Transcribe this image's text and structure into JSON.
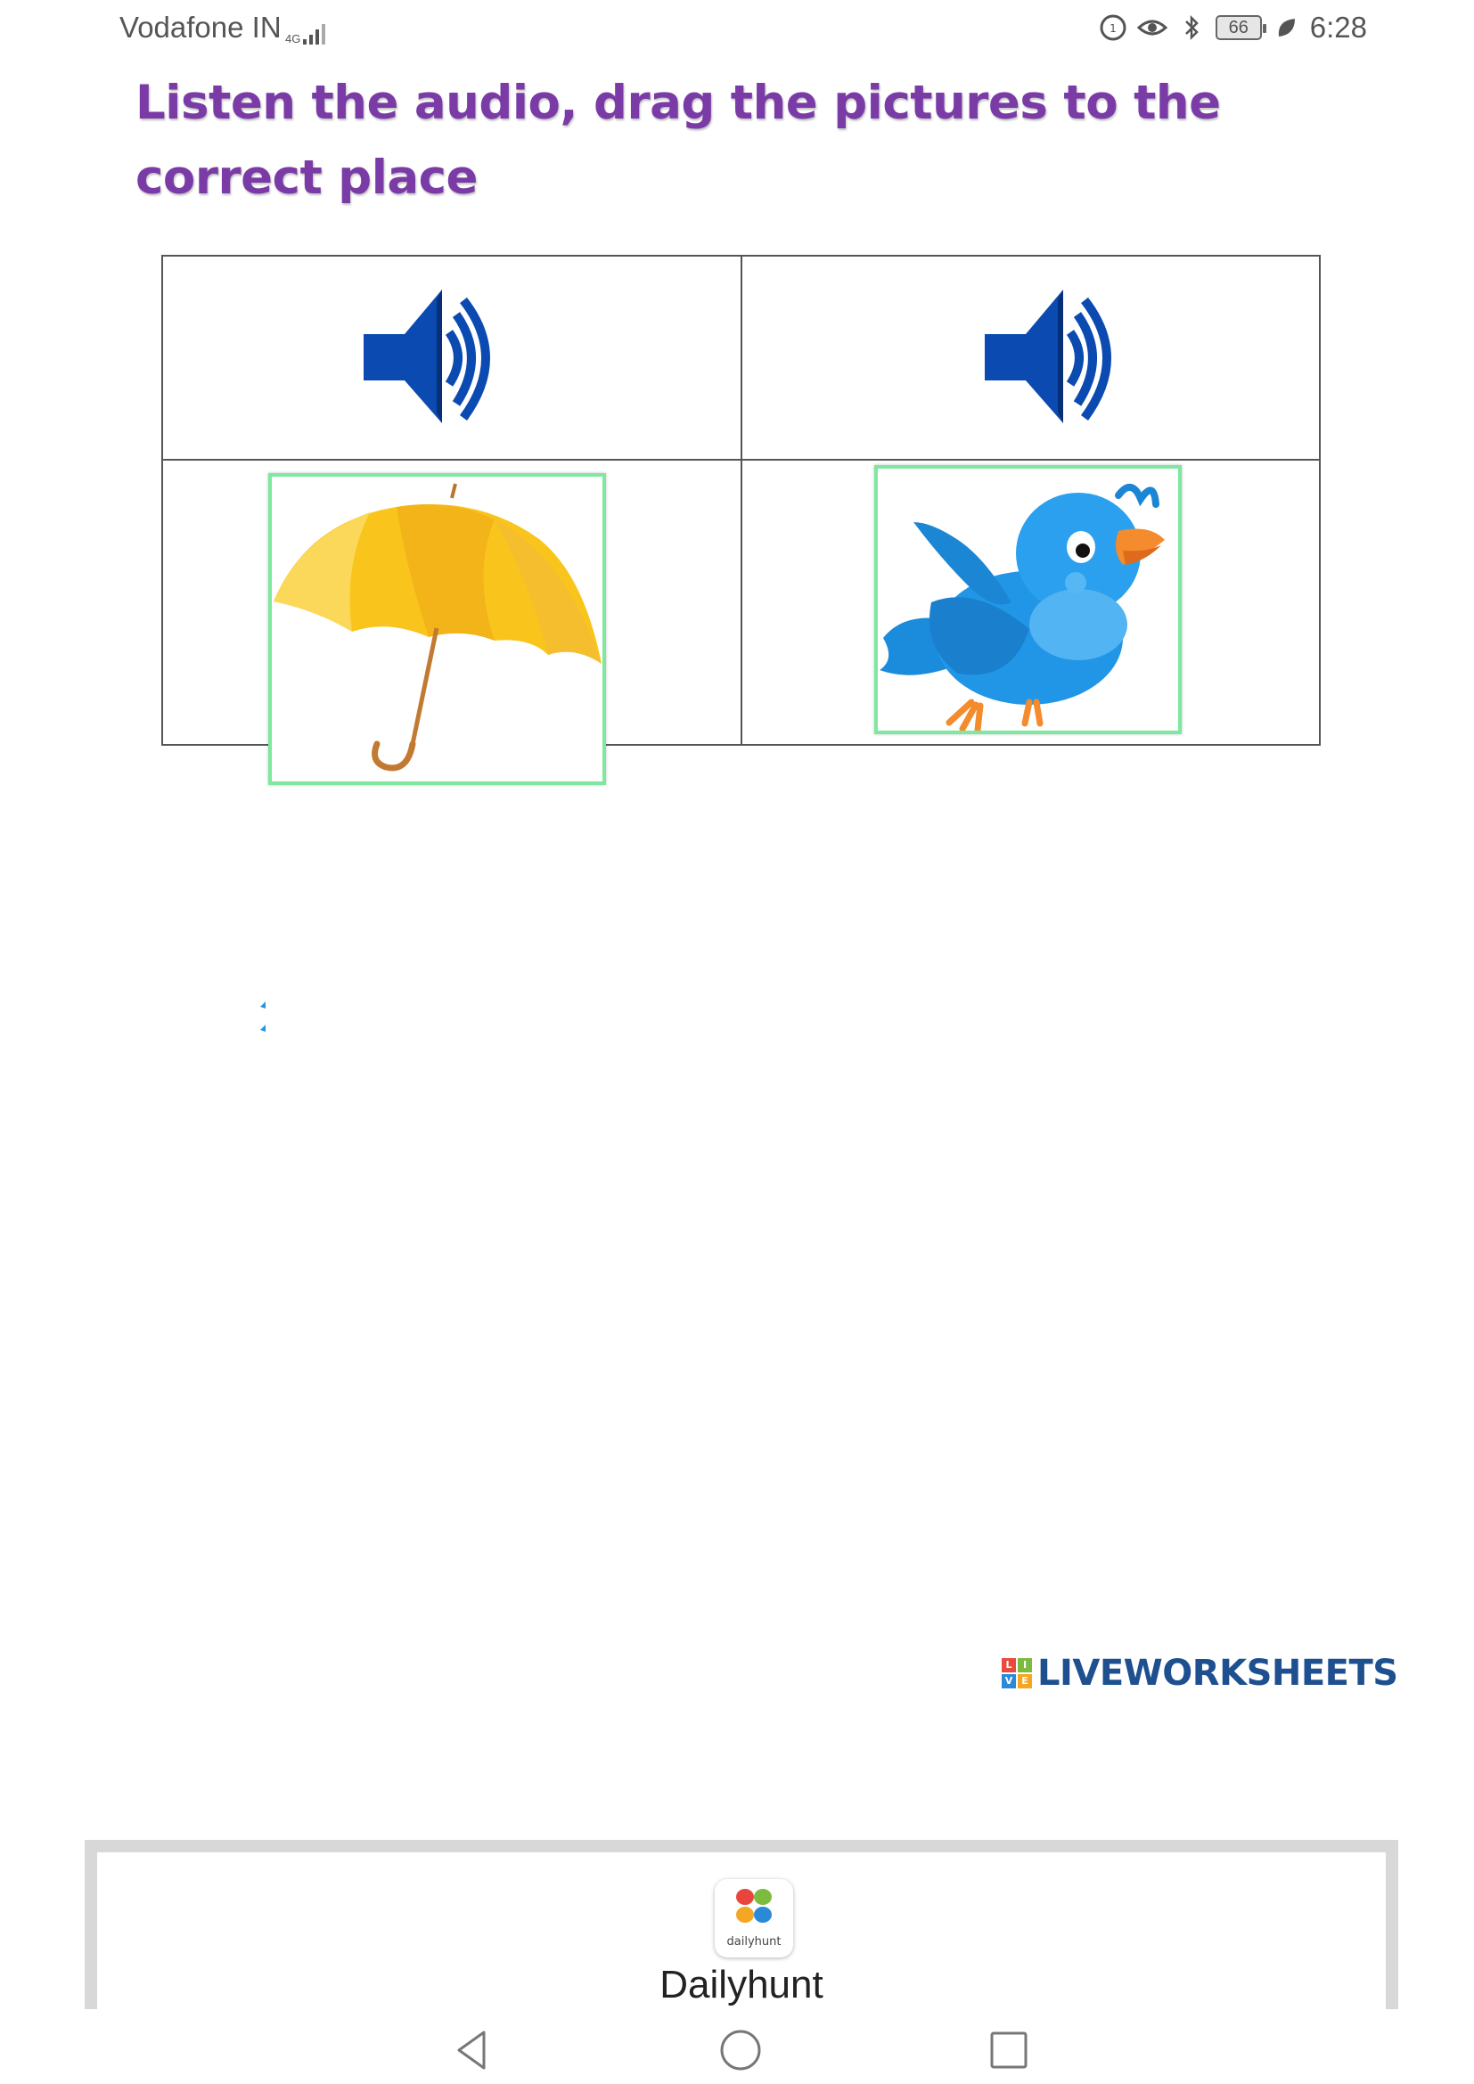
{
  "status_bar": {
    "carrier": "Vodafone IN",
    "network_type": "4G",
    "battery": "66",
    "time": "6:28"
  },
  "worksheet": {
    "instruction": "Listen the audio, drag the pictures to the correct place",
    "audio_cells": [
      {
        "icon": "speaker-icon"
      },
      {
        "icon": "speaker-icon"
      }
    ],
    "draggable_pictures": [
      {
        "name": "umbrella",
        "icon": "umbrella-picture"
      },
      {
        "name": "bird",
        "icon": "blue-bird-picture"
      }
    ]
  },
  "branding": {
    "logo_text": "LIVEWORKSHEETS",
    "logo_mark": [
      "L",
      "I",
      "V",
      "E"
    ]
  },
  "app_strip": {
    "icon_caption": "dailyhunt",
    "app_name": "Dailyhunt"
  },
  "nav": {
    "back": "back-icon",
    "home": "home-icon",
    "recents": "recents-icon"
  },
  "colors": {
    "instruction": "#7a3ba6",
    "speaker": "#0b4ab0",
    "card_border": "#7fe8a0",
    "logo": "#1e4f8f"
  }
}
